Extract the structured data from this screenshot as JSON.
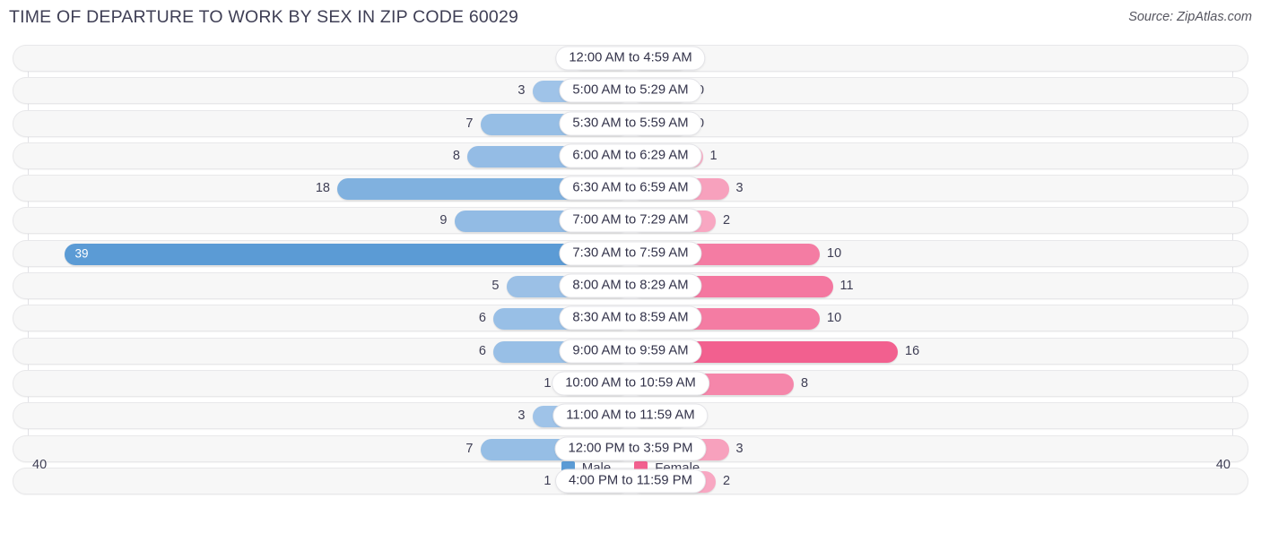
{
  "header": {
    "title": "TIME OF DEPARTURE TO WORK BY SEX IN ZIP CODE 60029",
    "source": "Source: ZipAtlas.com"
  },
  "axis": {
    "left_end": "40",
    "right_end": "40",
    "max": 40
  },
  "legend": {
    "items": [
      {
        "label": "Male",
        "color": "#5B9BD5"
      },
      {
        "label": "Female",
        "color": "#F2608F"
      }
    ]
  },
  "colors": {
    "male_low": "#A8C8EA",
    "male_high": "#5B9BD5",
    "female_low": "#F9B6CC",
    "female_high": "#F2608F",
    "track": "#F7F7F7",
    "track_border": "#E8E8EA",
    "text": "#3F3F55"
  },
  "chart_data": {
    "type": "bar",
    "orientation": "horizontal-diverging",
    "title": "Time of Departure to Work by Sex in Zip Code 60029",
    "xlabel": "",
    "ylabel": "",
    "xlim": [
      -40,
      40
    ],
    "axis_end_labels": [
      "40",
      "40"
    ],
    "grid": false,
    "legend_position": "bottom-center",
    "categories": [
      "12:00 AM to 4:59 AM",
      "5:00 AM to 5:29 AM",
      "5:30 AM to 5:59 AM",
      "6:00 AM to 6:29 AM",
      "6:30 AM to 6:59 AM",
      "7:00 AM to 7:29 AM",
      "7:30 AM to 7:59 AM",
      "8:00 AM to 8:29 AM",
      "8:30 AM to 8:59 AM",
      "9:00 AM to 9:59 AM",
      "10:00 AM to 10:59 AM",
      "11:00 AM to 11:59 AM",
      "12:00 PM to 3:59 PM",
      "4:00 PM to 11:59 PM"
    ],
    "series": [
      {
        "name": "Male",
        "color": "#5B9BD5",
        "values": [
          0,
          3,
          7,
          8,
          18,
          9,
          39,
          5,
          6,
          6,
          1,
          3,
          7,
          1
        ]
      },
      {
        "name": "Female",
        "color": "#F2608F",
        "values": [
          0,
          0,
          0,
          1,
          3,
          2,
          10,
          11,
          10,
          16,
          8,
          0,
          3,
          2
        ]
      }
    ]
  },
  "rows": [
    {
      "label": "12:00 AM to 4:59 AM",
      "male": "0",
      "female": "0"
    },
    {
      "label": "5:00 AM to 5:29 AM",
      "male": "3",
      "female": "0"
    },
    {
      "label": "5:30 AM to 5:59 AM",
      "male": "7",
      "female": "0"
    },
    {
      "label": "6:00 AM to 6:29 AM",
      "male": "8",
      "female": "1"
    },
    {
      "label": "6:30 AM to 6:59 AM",
      "male": "18",
      "female": "3"
    },
    {
      "label": "7:00 AM to 7:29 AM",
      "male": "9",
      "female": "2"
    },
    {
      "label": "7:30 AM to 7:59 AM",
      "male": "39",
      "female": "10"
    },
    {
      "label": "8:00 AM to 8:29 AM",
      "male": "5",
      "female": "11"
    },
    {
      "label": "8:30 AM to 8:59 AM",
      "male": "6",
      "female": "10"
    },
    {
      "label": "9:00 AM to 9:59 AM",
      "male": "6",
      "female": "16"
    },
    {
      "label": "10:00 AM to 10:59 AM",
      "male": "1",
      "female": "8"
    },
    {
      "label": "11:00 AM to 11:59 AM",
      "male": "3",
      "female": "0"
    },
    {
      "label": "12:00 PM to 3:59 PM",
      "male": "7",
      "female": "3"
    },
    {
      "label": "4:00 PM to 11:59 PM",
      "male": "1",
      "female": "2"
    }
  ]
}
